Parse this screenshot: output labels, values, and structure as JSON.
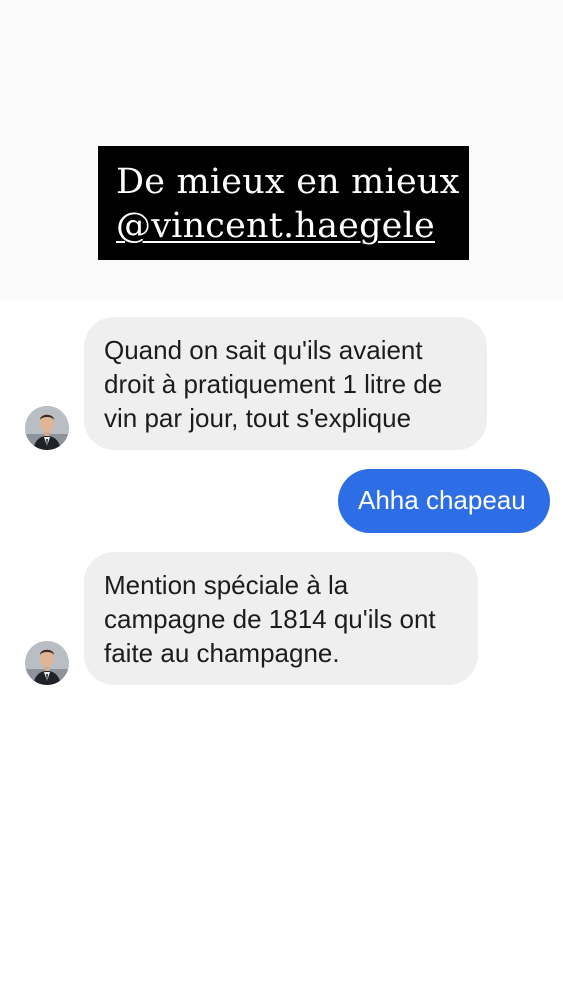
{
  "caption": {
    "line1": "De mieux en mieux",
    "handle": "@vincent.haegele"
  },
  "messages": [
    {
      "direction": "incoming",
      "lines": [
        "Quand on sait qu'ils avaient",
        "droit à pratiquement 1 litre de",
        "vin par jour, tout s'explique"
      ]
    },
    {
      "direction": "outgoing",
      "lines": [
        "Ahha chapeau"
      ]
    },
    {
      "direction": "incoming",
      "lines": [
        "Mention spéciale à la",
        "campagne de 1814 qu'ils ont",
        "faite au champagne."
      ]
    }
  ],
  "colors": {
    "outgoing_bubble": "#2d6ee6",
    "incoming_bubble": "#efefef",
    "caption_background": "#000000"
  },
  "icons": {
    "avatar": "profile-photo"
  }
}
